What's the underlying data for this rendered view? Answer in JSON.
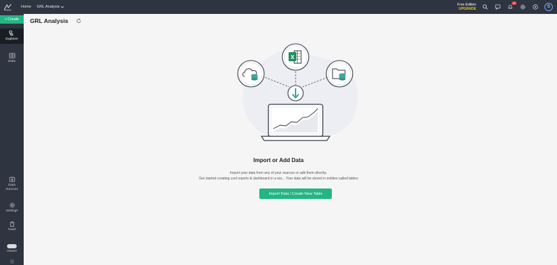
{
  "topbar": {
    "home_label": "Home",
    "workspace_label": "GRL Analysis",
    "edition_label": "Free Edition",
    "upgrade_label": "UPGRADE",
    "notification_count": "10",
    "user_initial": "S",
    "colors": {
      "bar_bg": "#2e3440",
      "upgrade": "#f5c518",
      "badge": "#e33b3b"
    }
  },
  "sidebar": {
    "create_label": "Create",
    "items": [
      {
        "label": "Explorer",
        "icon": "explorer-icon"
      },
      {
        "label": "Data",
        "icon": "table-icon"
      },
      {
        "label_line1": "Data",
        "label_line2": "Sources",
        "icon": "data-sources-icon"
      },
      {
        "label": "Settings",
        "icon": "gear-icon"
      },
      {
        "label": "Trash",
        "icon": "trash-icon"
      },
      {
        "label": "Viewer",
        "icon": "toggle-icon"
      }
    ],
    "colors": {
      "accent": "#23b585"
    }
  },
  "page": {
    "title": "GRL Analysis"
  },
  "empty_state": {
    "title": "Import or Add Data",
    "line1": "Import your data from any of your sources or add them directly.",
    "line2": "Get started creating cool reports & dashboard in a wiz... Your data will be stored in entities called tables",
    "button_label": "Import Data / Create New Table",
    "illustration_icons": [
      "cloud-database-icon",
      "excel-icon",
      "folder-database-icon",
      "download-arrow-icon",
      "laptop-chart-icon"
    ]
  }
}
